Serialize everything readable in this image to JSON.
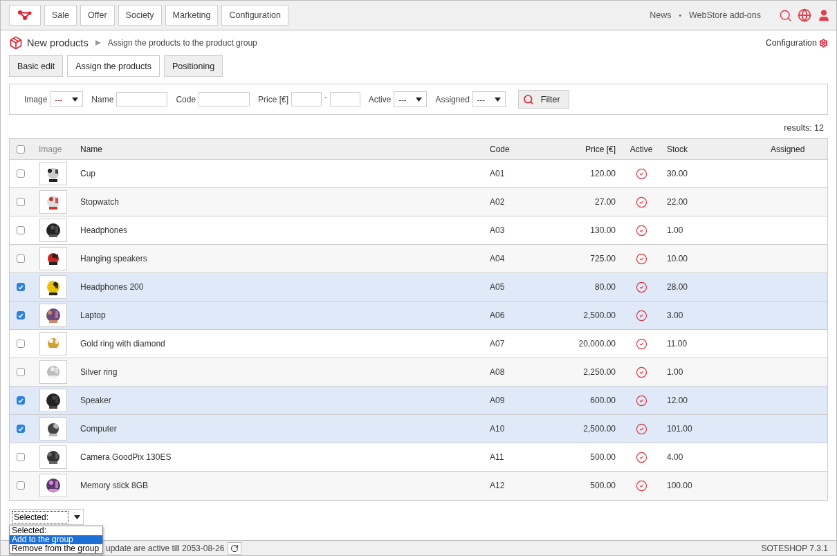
{
  "nav": {
    "items": [
      "Sale",
      "Offer",
      "Society",
      "Marketing",
      "Configuration"
    ],
    "links": [
      "News",
      "WebStore add-ons"
    ],
    "separator": "•"
  },
  "breadcrumb": {
    "title": "New products",
    "current": "Assign the products to the product group",
    "config": "Configuration"
  },
  "tabs": [
    {
      "label": "Basic edit",
      "selected": false
    },
    {
      "label": "Assign the products",
      "selected": true
    },
    {
      "label": "Positioning",
      "selected": false
    }
  ],
  "filters": [
    {
      "kind": "select",
      "label": "Image",
      "value": "---"
    },
    {
      "kind": "text",
      "label": "Name"
    },
    {
      "kind": "text",
      "label": "Code"
    },
    {
      "kind": "range",
      "label": "Price [€]",
      "separator": "-"
    },
    {
      "kind": "select",
      "label": "Active",
      "value": "---"
    },
    {
      "kind": "select",
      "label": "Assigned",
      "value": "---"
    }
  ],
  "filter_button": "Filter",
  "results": "results: 12",
  "table": {
    "all_checked": false,
    "columns": [
      "Image",
      "Name",
      "Code",
      "Price [€]",
      "Active",
      "Stock",
      "Assigned"
    ],
    "rows": [
      {
        "name": "Cup",
        "code": "A01",
        "price": "120.00",
        "active": true,
        "stock": "30.00",
        "selected": false
      },
      {
        "name": "Stopwatch",
        "code": "A02",
        "price": "27.00",
        "active": true,
        "stock": "22.00",
        "selected": false
      },
      {
        "name": "Headphones",
        "code": "A03",
        "price": "130.00",
        "active": true,
        "stock": "1.00",
        "selected": false
      },
      {
        "name": "Hanging speakers",
        "code": "A04",
        "price": "725.00",
        "active": true,
        "stock": "10.00",
        "selected": false
      },
      {
        "name": "Headphones 200",
        "code": "A05",
        "price": "80.00",
        "active": true,
        "stock": "28.00",
        "selected": true
      },
      {
        "name": "Laptop",
        "code": "A06",
        "price": "2,500.00",
        "active": true,
        "stock": "3.00",
        "selected": true
      },
      {
        "name": "Gold ring with diamond",
        "code": "A07",
        "price": "20,000.00",
        "active": true,
        "stock": "11.00",
        "selected": false
      },
      {
        "name": "Silver ring",
        "code": "A08",
        "price": "2,250.00",
        "active": true,
        "stock": "1.00",
        "selected": false
      },
      {
        "name": "Speaker",
        "code": "A09",
        "price": "600.00",
        "active": true,
        "stock": "12.00",
        "selected": true
      },
      {
        "name": "Computer",
        "code": "A10",
        "price": "2,500.00",
        "active": true,
        "stock": "101.00",
        "selected": true
      },
      {
        "name": "Camera GoodPix 130ES",
        "code": "A11",
        "price": "500.00",
        "active": true,
        "stock": "4.00",
        "selected": false
      },
      {
        "name": "Memory stick 8GB",
        "code": "A12",
        "price": "500.00",
        "active": true,
        "stock": "100.00",
        "selected": false
      }
    ]
  },
  "bulk_action": {
    "value": "Selected:",
    "expanded": true,
    "options": [
      {
        "label": "Selected:",
        "highlighted": false
      },
      {
        "label": "Add to the group",
        "highlighted": true
      },
      {
        "label": "Remove from the group",
        "highlighted": false
      }
    ]
  },
  "footer": {
    "notice": "update are active till 2053-08-26",
    "version": "SOTESHOP 7.3.1"
  }
}
